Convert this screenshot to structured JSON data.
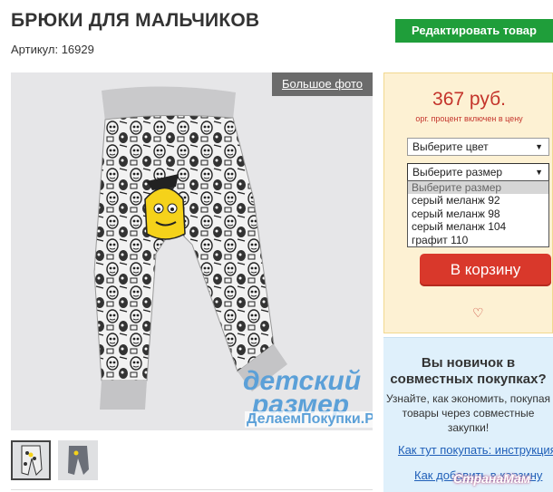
{
  "product": {
    "title": "БРЮКИ ДЛЯ МАЛЬЧИКОВ",
    "article": "Артикул: 16929",
    "edit_label": "Редактировать товар",
    "big_photo_label": "Большое фото"
  },
  "watermark": {
    "line1": "детский",
    "line2": "размер",
    "line3": "ДелаемПокупки.Ру"
  },
  "buy": {
    "price": "367 руб.",
    "price_note": "орг. процент включен в цену",
    "color_select": "Выберите цвет",
    "size_select": "Выберите размер",
    "size_options": [
      "Выберите размер",
      "серый меланж 92",
      "серый меланж 98",
      "серый меланж 104",
      "графит 110"
    ],
    "cart_label": "В корзину",
    "heart_icon": "heart-outline-icon"
  },
  "info": {
    "title": "Вы новичок в совместных покупках?",
    "text": "Узнайте, как экономить, покупая товары через совместные закупки!",
    "link1": "Как тут покупать: инструкция",
    "link2": "Как добавить в корзину"
  },
  "site_logo": "СтранаМам",
  "colors": {
    "accent_green": "#1f9e3a",
    "price_red": "#c4342b",
    "cart_red": "#d9382b",
    "buybox_bg": "#fdf1d3",
    "infobox_bg": "#dff0fb",
    "link_blue": "#1f5fb8"
  }
}
